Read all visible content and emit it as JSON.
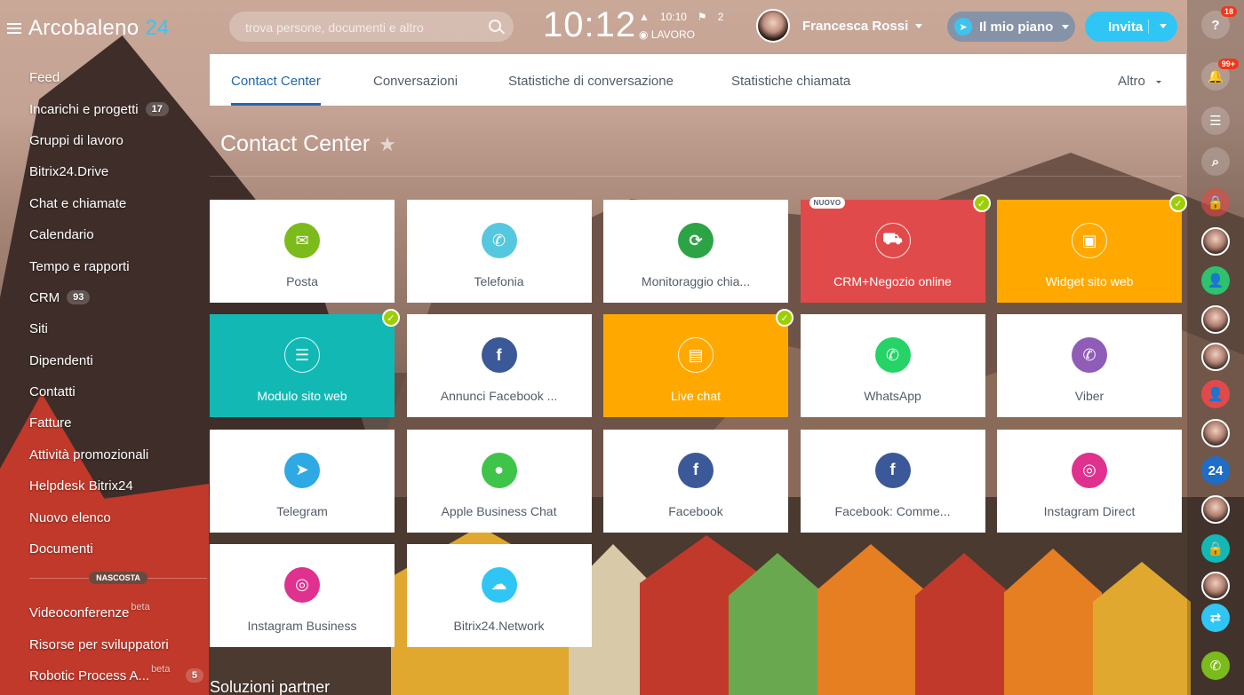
{
  "app": {
    "logo_name": "Arcobaleno",
    "logo_number": "24"
  },
  "sidebar": {
    "items": [
      {
        "label": "Feed",
        "count": ""
      },
      {
        "label": "Incarichi e progetti",
        "count": "17"
      },
      {
        "label": "Gruppi di lavoro",
        "count": ""
      },
      {
        "label": "Bitrix24.Drive",
        "count": ""
      },
      {
        "label": "Chat e chiamate",
        "count": ""
      },
      {
        "label": "Calendario",
        "count": ""
      },
      {
        "label": "Tempo e rapporti",
        "count": ""
      },
      {
        "label": "CRM",
        "count": "93"
      },
      {
        "label": "Siti",
        "count": ""
      },
      {
        "label": "Dipendenti",
        "count": ""
      },
      {
        "label": "Contatti",
        "count": ""
      },
      {
        "label": "Fatture",
        "count": ""
      },
      {
        "label": "Attività promozionali",
        "count": ""
      },
      {
        "label": "Helpdesk Bitrix24",
        "count": ""
      },
      {
        "label": "Nuovo elenco",
        "count": ""
      },
      {
        "label": "Documenti",
        "count": ""
      }
    ],
    "hidden_label": "NASCOSTA",
    "hidden_items": [
      {
        "label": "Videoconferenze",
        "beta": "beta",
        "count": ""
      },
      {
        "label": "Risorse per sviluppatori",
        "beta": "",
        "count": ""
      },
      {
        "label": "Robotic Process A...",
        "beta": "beta",
        "count": "5"
      }
    ]
  },
  "header": {
    "search_placeholder": "trova persone, documenti e altro",
    "clock": "10:12",
    "clock_time": "10:10",
    "clock_tasks": "2",
    "work_status": "LAVORO",
    "user_name": "Francesca Rossi",
    "plan_label": "Il mio piano",
    "invite_label": "Invita"
  },
  "tabs": {
    "items": [
      "Contact Center",
      "Conversazioni",
      "Statistiche di conversazione",
      "Statistiche chiamata"
    ],
    "more": "Altro"
  },
  "page": {
    "title": "Contact Center",
    "partner_title": "Soluzioni partner"
  },
  "tiles": [
    {
      "label": "Posta",
      "icon": "mail-icon",
      "color": "#7cbb1c",
      "bg": "#ffffff",
      "check": false,
      "new": ""
    },
    {
      "label": "Telefonia",
      "icon": "phone-icon",
      "color": "#55c8e0",
      "bg": "#ffffff",
      "check": false,
      "new": ""
    },
    {
      "label": "Monitoraggio chia...",
      "icon": "call-tracking-icon",
      "color": "#2ca446",
      "bg": "#ffffff",
      "check": false,
      "new": ""
    },
    {
      "label": "CRM+Negozio online",
      "icon": "shop-icon",
      "color": "#ffffff",
      "bg": "#e14a4a",
      "check": true,
      "new": "NUOVO"
    },
    {
      "label": "Widget sito web",
      "icon": "widget-icon",
      "color": "#ffffff",
      "bg": "#ffa900",
      "check": true,
      "new": ""
    },
    {
      "label": "Modulo sito web",
      "icon": "form-icon",
      "color": "#ffffff",
      "bg": "#12b9b4",
      "check": true,
      "new": ""
    },
    {
      "label": "Annunci Facebook ...",
      "icon": "facebook-ads-icon",
      "color": "#3b5998",
      "bg": "#ffffff",
      "check": false,
      "new": ""
    },
    {
      "label": "Live chat",
      "icon": "live-chat-icon",
      "color": "#ffffff",
      "bg": "#ffa900",
      "check": true,
      "new": ""
    },
    {
      "label": "WhatsApp",
      "icon": "whatsapp-icon",
      "color": "#25d366",
      "bg": "#ffffff",
      "check": false,
      "new": ""
    },
    {
      "label": "Viber",
      "icon": "viber-icon",
      "color": "#8f5db7",
      "bg": "#ffffff",
      "check": false,
      "new": ""
    },
    {
      "label": "Telegram",
      "icon": "telegram-icon",
      "color": "#2fa9e3",
      "bg": "#ffffff",
      "check": false,
      "new": ""
    },
    {
      "label": "Apple Business Chat",
      "icon": "apple-chat-icon",
      "color": "#3ec449",
      "bg": "#ffffff",
      "check": false,
      "new": ""
    },
    {
      "label": "Facebook",
      "icon": "facebook-icon",
      "color": "#3b5998",
      "bg": "#ffffff",
      "check": false,
      "new": ""
    },
    {
      "label": "Facebook: Comme...",
      "icon": "facebook-comments-icon",
      "color": "#3b5998",
      "bg": "#ffffff",
      "check": false,
      "new": ""
    },
    {
      "label": "Instagram Direct",
      "icon": "instagram-direct-icon",
      "color": "#e0318f",
      "bg": "#ffffff",
      "check": false,
      "new": ""
    },
    {
      "label": "Instagram Business",
      "icon": "instagram-business-icon",
      "color": "#e0318f",
      "bg": "#ffffff",
      "check": false,
      "new": ""
    },
    {
      "label": "Bitrix24.Network",
      "icon": "cloud-network-icon",
      "color": "#2fc6f6",
      "bg": "#ffffff",
      "check": false,
      "new": ""
    }
  ],
  "rightbar": {
    "help_count": "18",
    "notifications_count": "99+",
    "items": [
      "help-icon",
      "bell-icon",
      "chat-icon",
      "search-icon",
      "lock-icon",
      "avatar",
      "user-icon",
      "avatar",
      "avatar",
      "user-icon",
      "avatar",
      "bitrix24-icon",
      "avatar",
      "lock-icon",
      "avatar",
      "transfer-icon",
      "phone-icon"
    ],
    "accent": "#2fc6f6"
  }
}
